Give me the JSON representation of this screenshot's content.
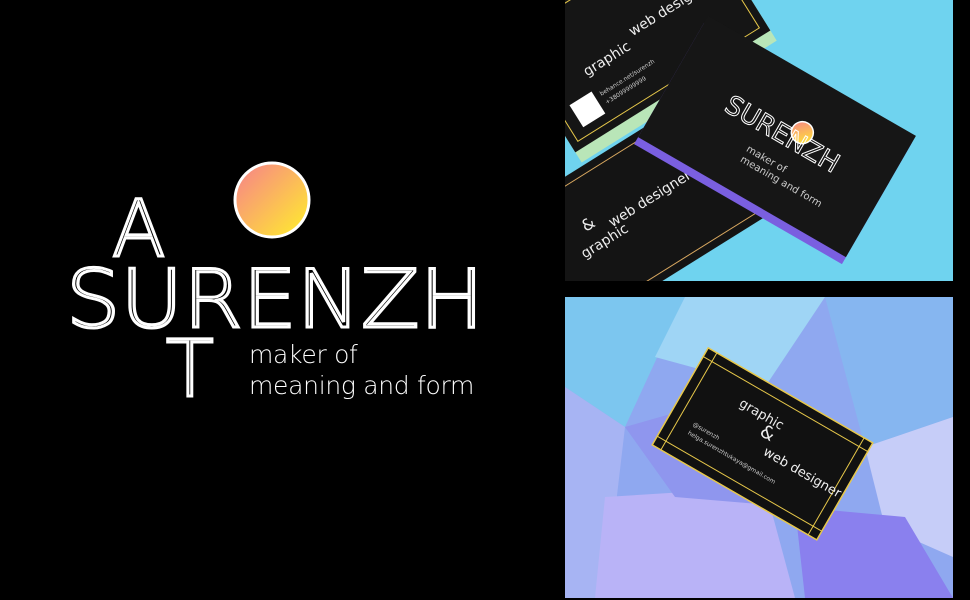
{
  "logo": {
    "letter_top": "A",
    "name": "SURENZH",
    "letter_bottom": "T",
    "tagline_line1": "maker of",
    "tagline_line2": "meaning and form"
  },
  "card_back": {
    "title_line1": "graphic",
    "ampersand": "&",
    "title_line2": "web designer",
    "handle": "@surenzh",
    "email": "helga.surenzhtukaya@gmail.com",
    "behance": "behance.net/surenzh",
    "phone": "+38099999999"
  },
  "colors": {
    "background": "#000000",
    "sun_top": "#f78a8a",
    "sun_bottom": "#ffe93a",
    "sky_blue": "#6fd3ef",
    "violet": "#8f86f0",
    "gold_line": "#e7c84a"
  }
}
